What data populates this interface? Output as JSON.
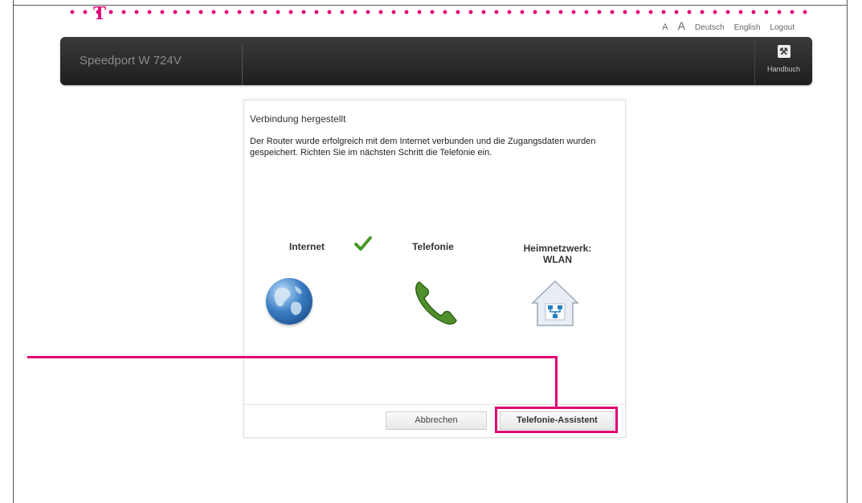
{
  "header": {
    "logo_letter": "T",
    "font_small": "A",
    "font_large": "A",
    "lang_de": "Deutsch",
    "lang_en": "English",
    "logout": "Logout"
  },
  "topbar": {
    "router_name": "Speedport W 724V",
    "handbuch_label": "Handbuch"
  },
  "panel": {
    "title": "Verbindung hergestellt",
    "text": "Der Router wurde erfolgreich mit dem Internet verbunden und die Zugangsdaten wurden gespeichert. Richten Sie im nächsten Schritt die Telefonie ein."
  },
  "steps": {
    "internet": "Internet",
    "telefonie": "Telefonie",
    "heim_line1": "Heimnetzwerk:",
    "heim_line2": "WLAN"
  },
  "buttons": {
    "cancel": "Abbrechen",
    "next": "Telefonie-Assistent"
  },
  "colors": {
    "brand_magenta": "#e20074",
    "check_green": "#4a9a2a"
  },
  "icons": [
    "globe-icon",
    "phone-icon",
    "home-network-icon",
    "checkmark-icon",
    "wrench-icon"
  ]
}
